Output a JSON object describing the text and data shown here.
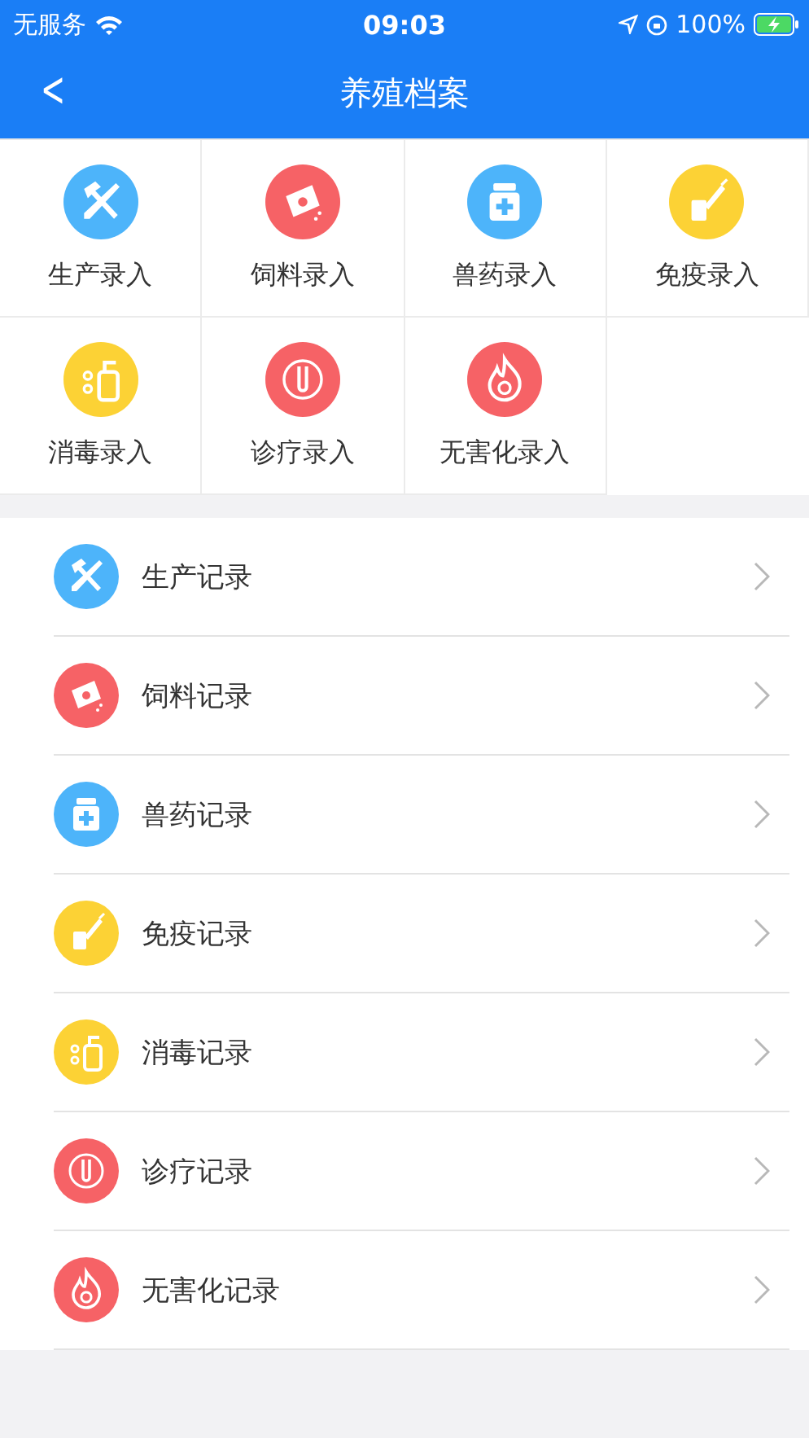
{
  "status_bar": {
    "carrier": "无服务",
    "time": "09:03",
    "battery": "100%"
  },
  "nav": {
    "back": "<",
    "title": "养殖档案"
  },
  "entry_grid": [
    {
      "label": "生产录入",
      "kind": "tools",
      "color": "#4db4fa"
    },
    {
      "label": "饲料录入",
      "kind": "feed",
      "color": "#f66266"
    },
    {
      "label": "兽药录入",
      "kind": "medicine",
      "color": "#4db4fa"
    },
    {
      "label": "免疫录入",
      "kind": "vaccine",
      "color": "#fcd235"
    },
    {
      "label": "消毒录入",
      "kind": "disinfect",
      "color": "#fcd235"
    },
    {
      "label": "诊疗录入",
      "kind": "diagnosis",
      "color": "#f66266"
    },
    {
      "label": "无害化录入",
      "kind": "harmless",
      "color": "#f66266"
    }
  ],
  "record_list": [
    {
      "label": "生产记录",
      "kind": "tools",
      "color": "#4db4fa"
    },
    {
      "label": "饲料记录",
      "kind": "feed",
      "color": "#f66266"
    },
    {
      "label": "兽药记录",
      "kind": "medicine",
      "color": "#4db4fa"
    },
    {
      "label": "免疫记录",
      "kind": "vaccine",
      "color": "#fcd235"
    },
    {
      "label": "消毒记录",
      "kind": "disinfect",
      "color": "#fcd235"
    },
    {
      "label": "诊疗记录",
      "kind": "diagnosis",
      "color": "#f66266"
    },
    {
      "label": "无害化记录",
      "kind": "harmless",
      "color": "#f66266"
    }
  ]
}
